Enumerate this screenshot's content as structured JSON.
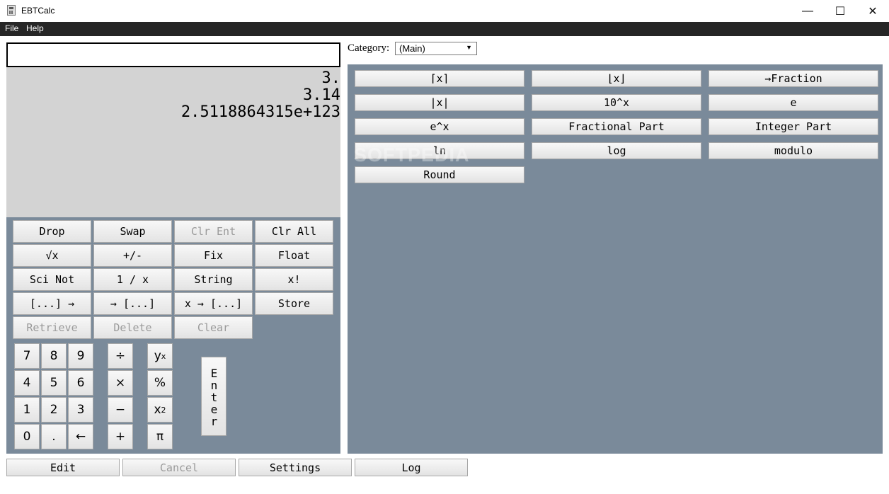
{
  "window": {
    "title": "EBTCalc",
    "minimize": "—",
    "maximize": "☐",
    "close": "✕"
  },
  "menu": {
    "file": "File",
    "help": "Help"
  },
  "entry": {
    "value": ""
  },
  "stack": [
    "3.",
    "3.14",
    "2.5118864315e+123"
  ],
  "category": {
    "label": "Category:",
    "selected": "(Main)"
  },
  "keys": {
    "drop": "Drop",
    "swap": "Swap",
    "clr_ent": "Clr Ent",
    "clr_all": "Clr All",
    "sqrt": "√x",
    "negate": "+/-",
    "fix": "Fix",
    "float": "Float",
    "sci_not": "Sci Not",
    "reciprocal": "1 / x",
    "string": "String",
    "factorial": "x!",
    "list_out": "[...] →",
    "list_in": "→ [...]",
    "x_to_list": "x → [...]",
    "store": "Store",
    "retrieve": "Retrieve",
    "delete": "Delete",
    "clear": "Clear"
  },
  "numpad": {
    "d7": "7",
    "d8": "8",
    "d9": "9",
    "d4": "4",
    "d5": "5",
    "d6": "6",
    "d1": "1",
    "d2": "2",
    "d3": "3",
    "d0": "0",
    "dot": ".",
    "backspace": "←",
    "divide": "÷",
    "multiply": "×",
    "subtract": "−",
    "add": "+",
    "power_base": "y",
    "power_exp": "x",
    "percent": "%",
    "square_base": "x",
    "square_exp": "2",
    "pi": "π",
    "enter": "Enter"
  },
  "functions": [
    "⌈x⌉",
    "⌊x⌋",
    "→Fraction",
    "|x|",
    "10^x",
    "e",
    "e^x",
    "Fractional Part",
    "Integer Part",
    "ln",
    "log",
    "modulo",
    "Round"
  ],
  "bottom": {
    "edit": "Edit",
    "cancel": "Cancel",
    "settings": "Settings",
    "log": "Log"
  },
  "watermark": "SOFTPEDIA"
}
